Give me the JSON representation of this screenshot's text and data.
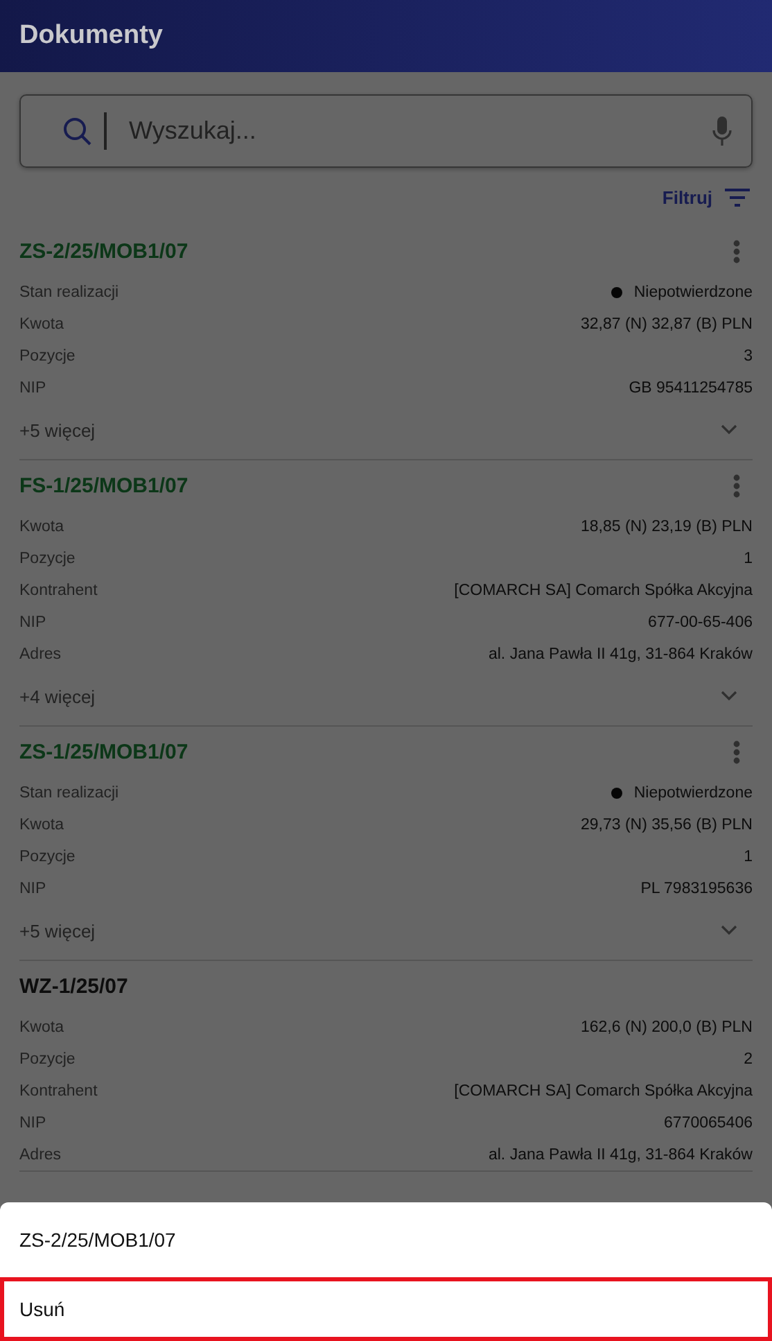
{
  "app_bar": {
    "title": "Dokumenty"
  },
  "search": {
    "placeholder": "Wyszukaj..."
  },
  "filter": {
    "label": "Filtruj"
  },
  "documents": [
    {
      "title": "ZS-2/25/MOB1/07",
      "kind": "mobile",
      "has_menu": true,
      "fields": [
        {
          "label": "Stan realizacji",
          "value": "Niepotwierdzone",
          "status_dot": true
        },
        {
          "label": "Kwota",
          "value": "32,87 (N) 32,87 (B) PLN",
          "status_dot": false
        },
        {
          "label": "Pozycje",
          "value": "3",
          "status_dot": false
        },
        {
          "label": "NIP",
          "value": "GB 95411254785",
          "status_dot": false
        }
      ],
      "more": "+5 więcej"
    },
    {
      "title": "FS-1/25/MOB1/07",
      "kind": "mobile",
      "has_menu": true,
      "fields": [
        {
          "label": "Kwota",
          "value": "18,85 (N) 23,19 (B) PLN",
          "status_dot": false
        },
        {
          "label": "Pozycje",
          "value": "1",
          "status_dot": false
        },
        {
          "label": "Kontrahent",
          "value": "[COMARCH SA] Comarch Spółka Akcyjna",
          "status_dot": false
        },
        {
          "label": "NIP",
          "value": "677-00-65-406",
          "status_dot": false
        },
        {
          "label": "Adres",
          "value": "al. Jana Pawła II 41g, 31-864 Kraków",
          "status_dot": false
        }
      ],
      "more": "+4 więcej"
    },
    {
      "title": "ZS-1/25/MOB1/07",
      "kind": "mobile",
      "has_menu": true,
      "fields": [
        {
          "label": "Stan realizacji",
          "value": "Niepotwierdzone",
          "status_dot": true
        },
        {
          "label": "Kwota",
          "value": "29,73 (N) 35,56 (B) PLN",
          "status_dot": false
        },
        {
          "label": "Pozycje",
          "value": "1",
          "status_dot": false
        },
        {
          "label": "NIP",
          "value": "PL 7983195636",
          "status_dot": false
        }
      ],
      "more": "+5 więcej"
    },
    {
      "title": "WZ-1/25/07",
      "kind": "standard",
      "has_menu": false,
      "fields": [
        {
          "label": "Kwota",
          "value": "162,6 (N) 200,0 (B) PLN",
          "status_dot": false
        },
        {
          "label": "Pozycje",
          "value": "2",
          "status_dot": false
        },
        {
          "label": "Kontrahent",
          "value": "[COMARCH SA] Comarch Spółka Akcyjna",
          "status_dot": false
        },
        {
          "label": "NIP",
          "value": "6770065406",
          "status_dot": false
        },
        {
          "label": "Adres",
          "value": "al. Jana Pawła II 41g, 31-864 Kraków",
          "status_dot": false
        }
      ]
    }
  ],
  "bottom_sheet": {
    "title": "ZS-2/25/MOB1/07",
    "actions": [
      {
        "label": "Usuń",
        "highlighted": true
      }
    ]
  }
}
